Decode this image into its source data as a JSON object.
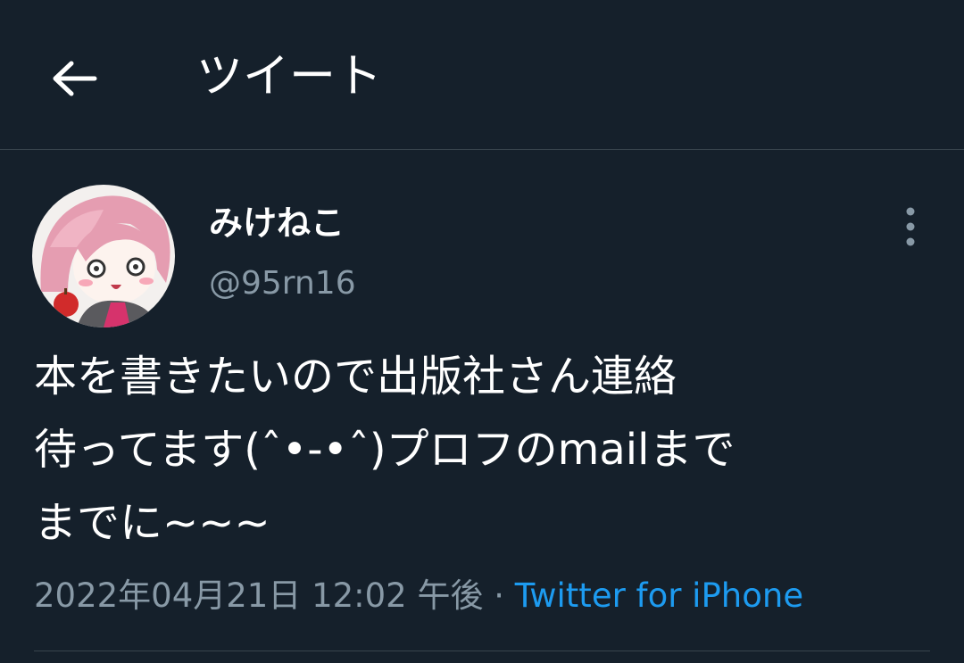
{
  "header": {
    "title": "ツイート",
    "back_icon": "back-arrow-icon"
  },
  "tweet": {
    "author": {
      "display_name": "みけねこ",
      "username": "@95rn16"
    },
    "more_icon": "more-vertical-icon",
    "text_lines": [
      "本を書きたいので出版社さん連絡",
      "待ってます(ˆ•-•ˆ)プロフのmailまで",
      "までに~~~"
    ],
    "timestamp": "2022年04月21日 12:02 午後",
    "separator": " · ",
    "source": "Twitter for iPhone"
  },
  "colors": {
    "background": "#15202b",
    "border": "#38444d",
    "secondary_text": "#8899a6",
    "link": "#1d9bf0"
  }
}
